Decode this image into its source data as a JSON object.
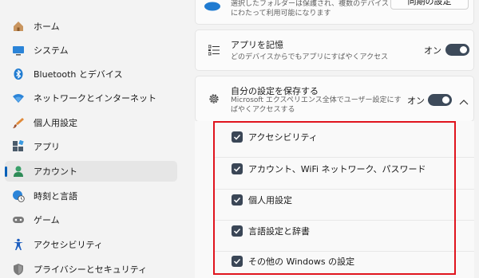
{
  "sidebar": {
    "items": [
      {
        "label": "ホーム",
        "icon": "home-icon",
        "color": "#c47a3a"
      },
      {
        "label": "システム",
        "icon": "monitor-icon",
        "color": "#1f7bd1"
      },
      {
        "label": "Bluetooth とデバイス",
        "icon": "bluetooth-icon",
        "color": "#1f7bd1"
      },
      {
        "label": "ネットワークとインターネット",
        "icon": "wifi-icon",
        "color": "#1f7bd1"
      },
      {
        "label": "個人用設定",
        "icon": "brush-icon",
        "color": "#e08a3a"
      },
      {
        "label": "アプリ",
        "icon": "apps-icon",
        "color": "#4a5a6a"
      },
      {
        "label": "アカウント",
        "icon": "account-icon",
        "color": "#2e8b57"
      },
      {
        "label": "時刻と言語",
        "icon": "globe-clock-icon",
        "color": "#1f7bd1"
      },
      {
        "label": "ゲーム",
        "icon": "gamepad-icon",
        "color": "#6a6a6a"
      },
      {
        "label": "アクセシビリティ",
        "icon": "accessibility-icon",
        "color": "#1f5fbf"
      },
      {
        "label": "プライバシーとセキュリティ",
        "icon": "shield-icon",
        "color": "#6a6a6a"
      }
    ],
    "selected_index": 6
  },
  "top_card": {
    "desc": "選択したフォルダーは保護され、複数のデバイスにわたって利用可能になります",
    "button_label": "同期の設定"
  },
  "apps_card": {
    "title": "アプリを記憶",
    "desc": "どのデバイスからでもアプリにすばやくアクセス",
    "toggle_label": "オン",
    "toggle_on": true
  },
  "prefs_card": {
    "title": "自分の設定を保存する",
    "desc": "Microsoft エクスペリエンス全体でユーザー設定にすばやくアクセスする",
    "toggle_label": "オン",
    "toggle_on": true
  },
  "checklist": [
    {
      "label": "アクセシビリティ",
      "checked": true
    },
    {
      "label": "アカウント、WiFi ネットワーク、パスワード",
      "checked": true
    },
    {
      "label": "個人用設定",
      "checked": true
    },
    {
      "label": "言語設定と辞書",
      "checked": true
    },
    {
      "label": "その他の Windows の設定",
      "checked": true
    }
  ],
  "colors": {
    "accent": "#005fb8",
    "highlight": "#e0141e",
    "toggle": "#3d4a5a"
  }
}
